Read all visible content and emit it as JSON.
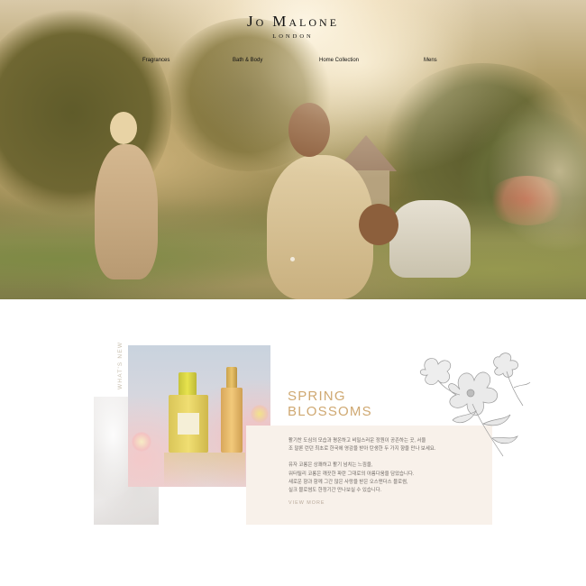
{
  "header": {
    "logo_main": "Jo Malone",
    "logo_sub": "London"
  },
  "nav": {
    "items": [
      {
        "label": "Fragrances"
      },
      {
        "label": "Bath & Body"
      },
      {
        "label": "Home Collection"
      },
      {
        "label": "Mens"
      }
    ]
  },
  "feature": {
    "section_label": "WHAT'S NEW",
    "headline_line1": "SPRING",
    "headline_line2": "BLOSSOMS",
    "body_lines": [
      "활기찬 도심의 모습과 평온하고 비밀스러운 정원이 공존하는 곳, 서울",
      "조 말론 런던 최초로 한국에 영감을 받아 탄생한 두 가지 향을 만나 보세요.",
      "",
      "유자 코롱은 상쾌하고 활기 넘치는 느낌을,",
      "워터릴리 코롱은 깨끗한 파란 그대로의 아름다움을 담았습니다.",
      "새로운 향과 함께 그간 많은 사랑을 받은 오스맨더스 블로썸,",
      "실크 블로썸도 한정기간 만나보실 수 있습니다."
    ],
    "cta_label": "VIEW MORE"
  },
  "colors": {
    "accent": "#cfa871",
    "card_bg": "#f8f1ea",
    "body_text": "#6f6a66"
  },
  "icons": [
    "flower-illustration-icon",
    "slider-dot-icon"
  ]
}
